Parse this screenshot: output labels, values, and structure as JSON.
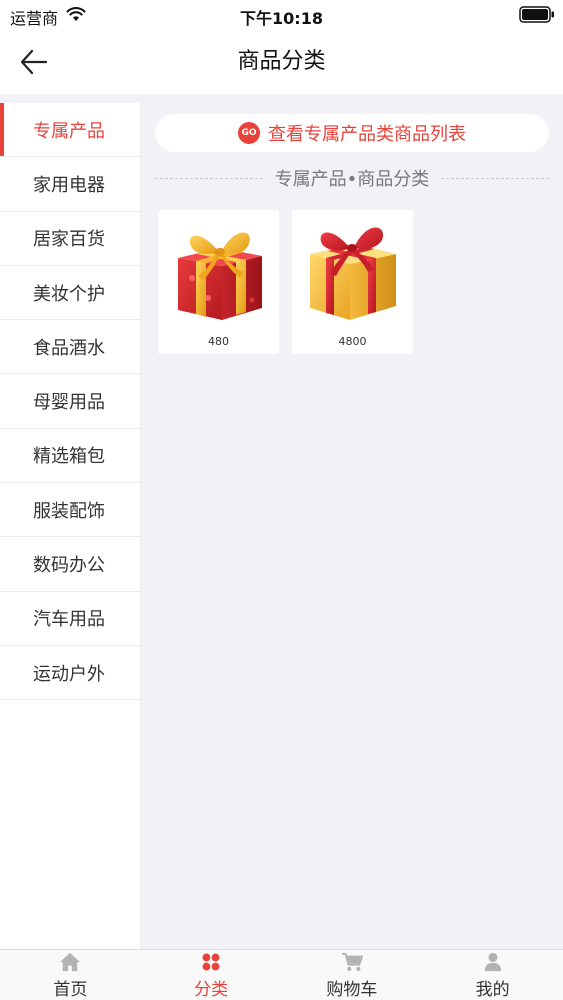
{
  "status_bar": {
    "carrier": "运营商",
    "time": "下午10:18"
  },
  "nav": {
    "title": "商品分类"
  },
  "sidebar": {
    "items": [
      {
        "label": "专属产品",
        "active": true
      },
      {
        "label": "家用电器",
        "active": false
      },
      {
        "label": "居家百货",
        "active": false
      },
      {
        "label": "美妆个护",
        "active": false
      },
      {
        "label": "食品酒水",
        "active": false
      },
      {
        "label": "母婴用品",
        "active": false
      },
      {
        "label": "精选箱包",
        "active": false
      },
      {
        "label": "服装配饰",
        "active": false
      },
      {
        "label": "数码办公",
        "active": false
      },
      {
        "label": "汽车用品",
        "active": false
      },
      {
        "label": "运动户外",
        "active": false
      }
    ]
  },
  "main": {
    "go_badge": "GO",
    "view_all_label": "查看专属产品类商品列表",
    "section_title": "专属产品•商品分类",
    "products": [
      {
        "price": "480",
        "image": "red-gift-box-icon"
      },
      {
        "price": "4800",
        "image": "gold-gift-box-icon"
      }
    ]
  },
  "tab_bar": {
    "tabs": [
      {
        "label": "首页",
        "icon": "home-icon",
        "active": false
      },
      {
        "label": "分类",
        "icon": "category-icon",
        "active": true
      },
      {
        "label": "购物车",
        "icon": "cart-icon",
        "active": false
      },
      {
        "label": "我的",
        "icon": "profile-icon",
        "active": false
      }
    ]
  },
  "colors": {
    "accent": "#e8423a",
    "panel_bg": "#f2f1f6",
    "icon_gray": "#b3b3b3"
  }
}
